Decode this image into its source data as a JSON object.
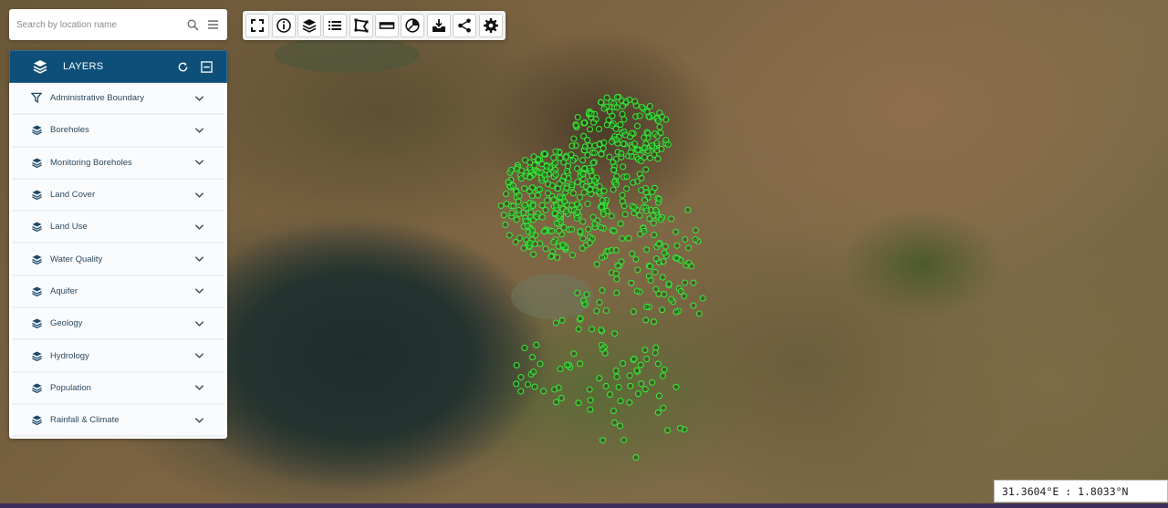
{
  "search": {
    "placeholder": "Search by location name",
    "icons": [
      "search-icon",
      "menu-icon"
    ]
  },
  "toolbar": {
    "buttons": [
      {
        "name": "fullscreen",
        "icon": "fullscreen-icon"
      },
      {
        "name": "info",
        "icon": "info-icon"
      },
      {
        "name": "basemap-layers",
        "icon": "layers-stack-icon"
      },
      {
        "name": "legend-list",
        "icon": "list-icon"
      },
      {
        "name": "measure-area",
        "icon": "polygon-draw-icon"
      },
      {
        "name": "scale-ruler",
        "icon": "ruler-icon"
      },
      {
        "name": "statistics",
        "icon": "pie-chart-icon"
      },
      {
        "name": "download",
        "icon": "download-icon"
      },
      {
        "name": "share",
        "icon": "share-icon"
      },
      {
        "name": "settings",
        "icon": "gear-icon"
      }
    ]
  },
  "layers_panel": {
    "title": "LAYERS",
    "header_icon": "layers-stack-icon",
    "header_buttons": [
      "refresh-icon",
      "collapse-icon"
    ],
    "items": [
      {
        "label": "Administrative Boundary",
        "icon": "boundary-filter-icon"
      },
      {
        "label": "Boreholes",
        "icon": "layers-stack-icon"
      },
      {
        "label": "Monitoring Boreholes",
        "icon": "layers-stack-icon"
      },
      {
        "label": "Land Cover",
        "icon": "layers-stack-icon"
      },
      {
        "label": "Land Use",
        "icon": "layers-stack-icon"
      },
      {
        "label": "Water Quality",
        "icon": "layers-stack-icon"
      },
      {
        "label": "Aquifer",
        "icon": "layers-stack-icon"
      },
      {
        "label": "Geology",
        "icon": "layers-stack-icon"
      },
      {
        "label": "Hydrology",
        "icon": "layers-stack-icon"
      },
      {
        "label": "Population",
        "icon": "layers-stack-icon"
      },
      {
        "label": "Rainfall & Climate",
        "icon": "layers-stack-icon"
      }
    ]
  },
  "coordinates": {
    "text": "31.3604°E : 1.8033°N"
  },
  "colors": {
    "header": "#0e4f79",
    "point_stroke": "#39e639",
    "label_text": "#2c4a60"
  }
}
